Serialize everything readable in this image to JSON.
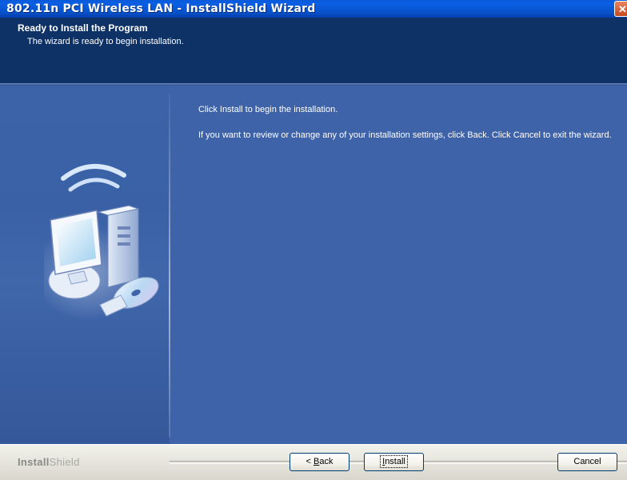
{
  "window": {
    "title": "802.11n PCI Wireless LAN - InstallShield Wizard",
    "close_glyph": "✕"
  },
  "header": {
    "title": "Ready to Install the Program",
    "subtitle": "The wizard is ready to begin installation."
  },
  "body": {
    "paragraph_1": "Click Install to begin the installation.",
    "paragraph_2": "If you want to review or change any of your installation settings, click Back. Click Cancel to exit the wizard."
  },
  "side_image": {
    "icon": "computer-wireless-cd-icon"
  },
  "footer": {
    "brand_part_1": "Install",
    "brand_part_2": "Shield",
    "buttons": {
      "back_prefix": "< ",
      "back_mnemonic": "B",
      "back_rest": "ack",
      "install_mnemonic": "I",
      "install_rest": "nstall",
      "cancel": "Cancel"
    }
  },
  "colors": {
    "title_bar": "#0b5fe4",
    "header_bg": "#0f3266",
    "content_bg": "#3f63a8",
    "footer_bg": "#ece9d8",
    "close_button": "#d9542a"
  }
}
